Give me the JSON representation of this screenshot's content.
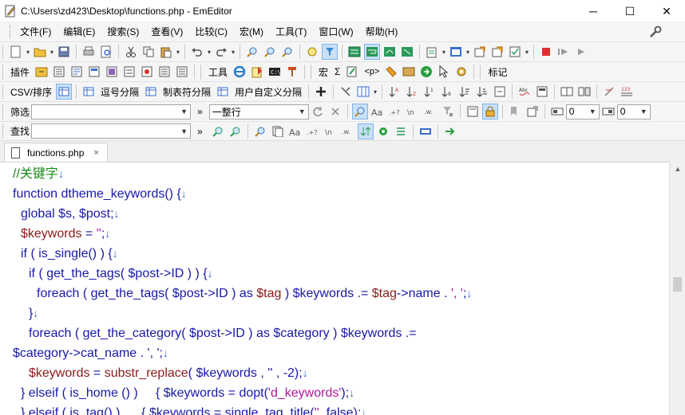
{
  "window": {
    "title": "C:\\Users\\zd423\\Desktop\\functions.php - EmEditor",
    "minimize": "─",
    "maximize": "☐",
    "close": "✕"
  },
  "menu": [
    "文件(F)",
    "编辑(E)",
    "搜索(S)",
    "查看(V)",
    "比较(C)",
    "宏(M)",
    "工具(T)",
    "窗口(W)",
    "帮助(H)"
  ],
  "toolbar3": {
    "plugins_label": "插件",
    "tools_label": "工具",
    "macro_label": "宏",
    "sigma": "Σ",
    "p_tag": "<p>",
    "marker_label": "标记"
  },
  "toolbar4": {
    "csv_label": "CSV/排序",
    "comma_label": "逗号分隔",
    "tab_label": "制表符分隔",
    "user_label": "用户自定义分隔"
  },
  "filter_bar": {
    "label": "筛选",
    "mode_value": "一整行",
    "chevron": "»",
    "num1": "0",
    "num2": "0"
  },
  "find_bar": {
    "label": "查找",
    "chevron": "»"
  },
  "tab": {
    "filename": "functions.php",
    "close": "×"
  },
  "code": {
    "l1_comment": "//关键字",
    "l2_kw": "function",
    "l2_rest": " dtheme_keywords() {",
    "l3_kw": "global",
    "l3_rest": " $s, $post;",
    "l4_var": "$keywords",
    "l4_eq": " = ",
    "l4_str": "''",
    "l4_end": ";",
    "l5_kw": "if",
    "l5_rest": " ( is_single() ) {",
    "l6_kw": "if",
    "l6_rest": " ( get_the_tags( $post->ID ) ) {",
    "l7_kw": "foreach",
    "l7_a": " ( get_the_tags( $post->ID ) as ",
    "l7_var": "$tag",
    "l7_b": " ) $keywords .= ",
    "l7_var2": "$tag",
    "l7_c": "->name . ",
    "l7_str": "', '",
    "l7_end": ";",
    "l8": "}",
    "l9_kw": "foreach",
    "l9_rest": " ( get_the_category( $post->ID ) as $category ) $keywords .=",
    "l10": "$category->cat_name . ', ';",
    "l11_var": "$keywords",
    "l11_eq": " = ",
    "l11_fn": "substr_replace",
    "l11_rest": "( $keywords , '' , -2);",
    "l12_a": "} ",
    "l12_kw": "elseif",
    "l12_b": " ( is_home () )     { $keywords = dopt(",
    "l12_str": "'d_keywords'",
    "l12_c": ");",
    "l13_a": "} ",
    "l13_kw": "elseif",
    "l13_b": " ( is_tag() )      { $keywords = single_tag_title(",
    "l13_str": "''",
    "l13_c": ", false);",
    "newline_mark": "↓"
  }
}
